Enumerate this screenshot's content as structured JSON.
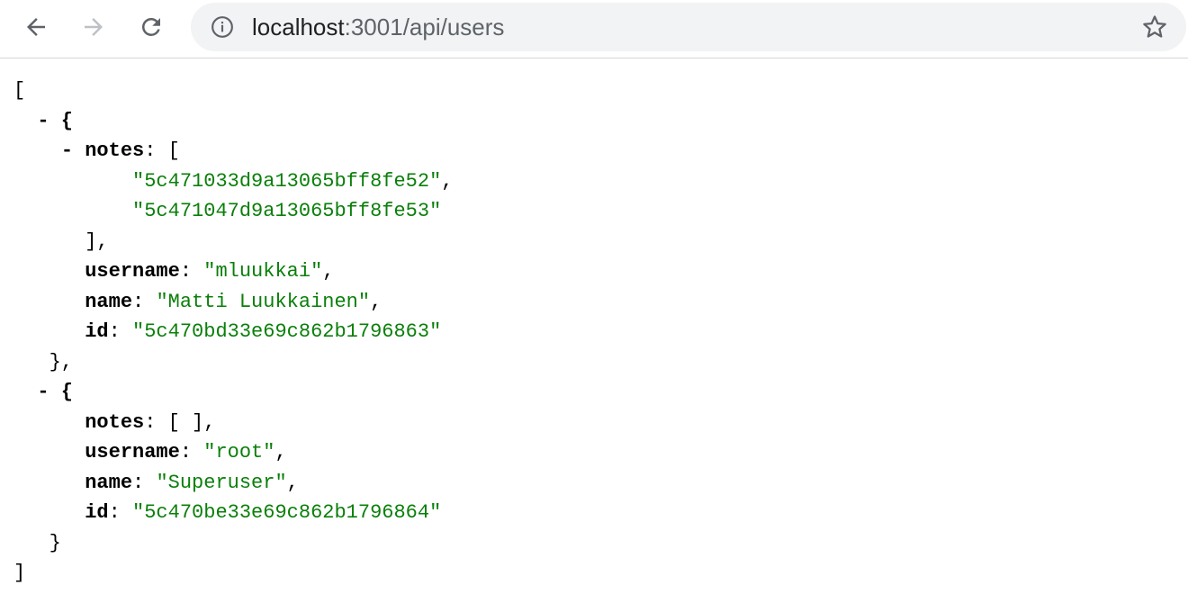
{
  "browser": {
    "url_host": "localhost",
    "url_path": ":3001/api/users",
    "icons": {
      "back": "back-arrow-icon",
      "forward": "forward-arrow-icon",
      "reload": "reload-icon",
      "info": "info-icon",
      "bookmark": "star-icon"
    }
  },
  "json_view": {
    "open_bracket": "[",
    "close_bracket": "]",
    "items": [
      {
        "collapser": "- {",
        "notes_collapser": "- ",
        "notes_key": "notes",
        "notes_open": ": [",
        "notes_values": [
          "\"5c471033d9a13065bff8fe52\"",
          "\"5c471047d9a13065bff8fe53\""
        ],
        "notes_close": "],",
        "username_key": "username",
        "username_value": "\"mluukkai\"",
        "name_key": "name",
        "name_value": "\"Matti Luukkainen\"",
        "id_key": "id",
        "id_value": "\"5c470bd33e69c862b1796863\"",
        "close": "},"
      },
      {
        "collapser": "- {",
        "notes_key": "notes",
        "notes_empty": ": [ ],",
        "username_key": "username",
        "username_value": "\"root\"",
        "name_key": "name",
        "name_value": "\"Superuser\"",
        "id_key": "id",
        "id_value": "\"5c470be33e69c862b1796864\"",
        "close": "}"
      }
    ]
  },
  "colors": {
    "string": "#0a7f0a",
    "key": "#000000",
    "omnibox_bg": "#f1f3f4"
  }
}
